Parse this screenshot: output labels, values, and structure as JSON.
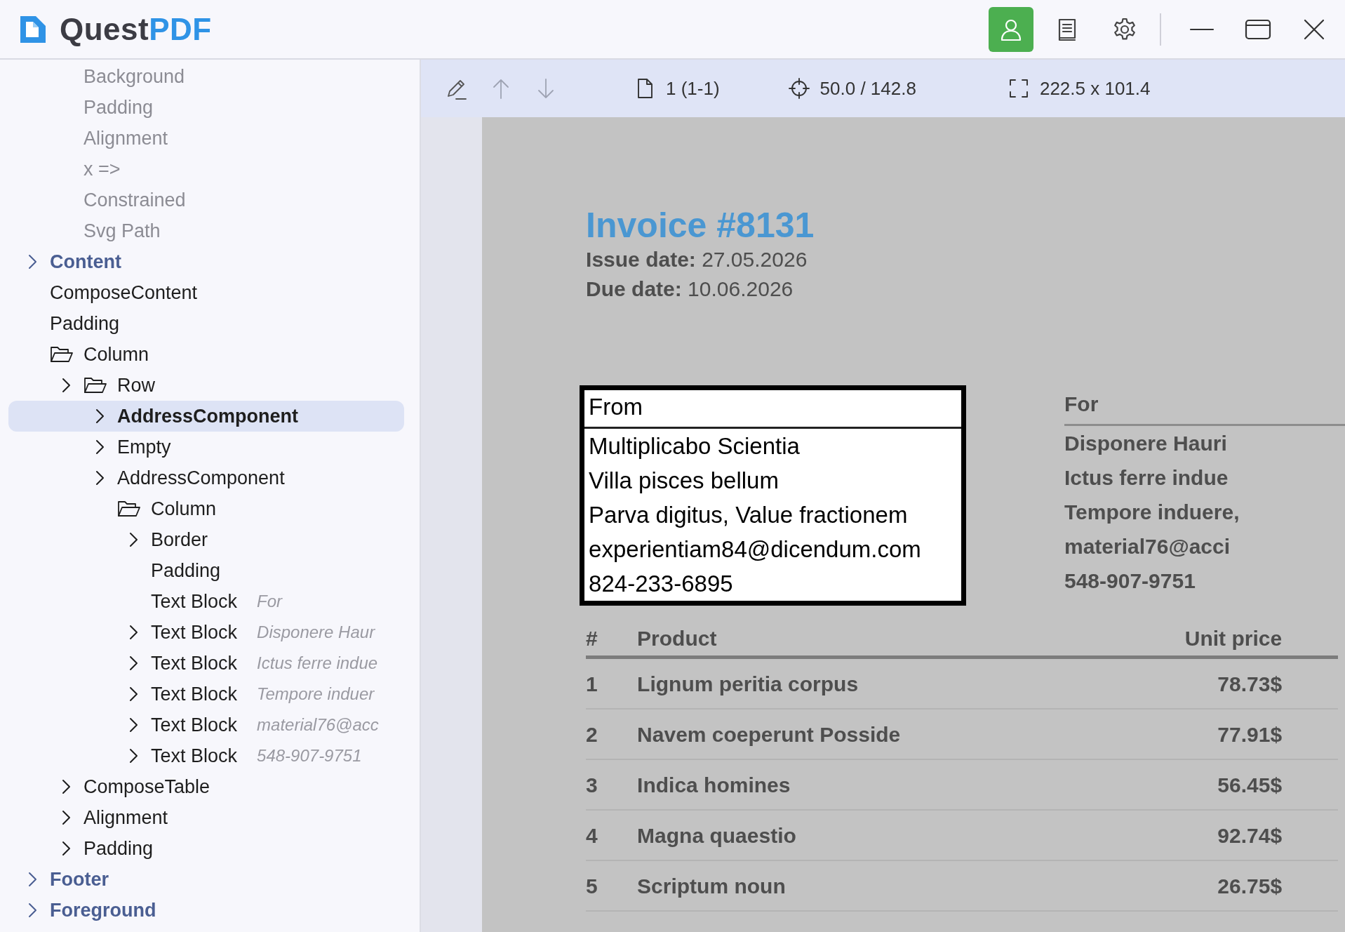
{
  "app": {
    "logo_main": "Quest",
    "logo_accent": "PDF"
  },
  "header_buttons": [
    {
      "kind": "user",
      "selected": true
    },
    {
      "kind": "book",
      "selected": false
    },
    {
      "kind": "settings",
      "selected": false
    }
  ],
  "tree": [
    {
      "children": [
        {
          "label": "Background",
          "kind": "hidden",
          "expandable": false,
          "selected": false
        },
        {
          "label": "Padding",
          "kind": "hidden",
          "expandable": false,
          "selected": false
        },
        {
          "label": "Alignment",
          "kind": "hidden",
          "expandable": false,
          "selected": false
        },
        {
          "label": "x =>",
          "kind": "hidden",
          "expandable": false,
          "selected": false
        },
        {
          "label": "Constrained",
          "kind": "hidden",
          "expandable": false,
          "selected": false
        },
        {
          "label": "Svg Path",
          "kind": "hidden",
          "expandable": false,
          "selected": false
        }
      ]
    },
    {
      "label": "Content",
      "kind": "section",
      "expandable": true,
      "selected": false
    },
    {
      "label": "ComposeContent",
      "kind": "node",
      "expandable": false,
      "selected": false
    },
    {
      "label": "Padding",
      "kind": "node",
      "expandable": false,
      "selected": false
    },
    {
      "label": "Column",
      "kind": "group",
      "expandable": false,
      "selected": false,
      "children": [
        {
          "label": "Row",
          "kind": "group",
          "expandable": true,
          "selected": false,
          "children": [
            {
              "label": "AddressComponent",
              "kind": "node",
              "expandable": true,
              "selected": true
            },
            {
              "label": "Empty",
              "kind": "node",
              "expandable": true,
              "selected": false
            },
            {
              "label": "AddressComponent",
              "kind": "node",
              "expandable": true,
              "selected": false
            },
            {
              "label": "Column",
              "kind": "group",
              "expandable": false,
              "selected": false,
              "children": [
                {
                  "label": "Border",
                  "kind": "node",
                  "expandable": true,
                  "selected": false
                },
                {
                  "label": "Padding",
                  "kind": "node",
                  "expandable": false,
                  "selected": false
                },
                {
                  "label": "Text Block",
                  "kind": "node",
                  "expandable": false,
                  "selected": false,
                  "hint": "For"
                },
                {
                  "label": "Text Block",
                  "kind": "node",
                  "expandable": true,
                  "selected": false,
                  "hint": "Disponere Haur"
                },
                {
                  "label": "Text Block",
                  "kind": "node",
                  "expandable": true,
                  "selected": false,
                  "hint": "Ictus ferre indue"
                },
                {
                  "label": "Text Block",
                  "kind": "node",
                  "expandable": true,
                  "selected": false,
                  "hint": "Tempore induer"
                },
                {
                  "label": "Text Block",
                  "kind": "node",
                  "expandable": true,
                  "selected": false,
                  "hint": "material76@acc"
                },
                {
                  "label": "Text Block",
                  "kind": "node",
                  "expandable": true,
                  "selected": false,
                  "hint": "548-907-9751"
                }
              ]
            }
          ]
        },
        {
          "label": "ComposeTable",
          "kind": "node",
          "expandable": true,
          "selected": false
        },
        {
          "label": "Alignment",
          "kind": "node",
          "expandable": true,
          "selected": false
        },
        {
          "label": "Padding",
          "kind": "node",
          "expandable": true,
          "selected": false
        }
      ]
    },
    {
      "label": "Footer",
      "kind": "section",
      "expandable": true,
      "selected": false
    },
    {
      "label": "Foreground",
      "kind": "section",
      "expandable": true,
      "selected": false
    }
  ],
  "toolbar": {
    "tools": [
      {
        "kind": "edit",
        "disabled": false
      },
      {
        "kind": "up",
        "disabled": true
      },
      {
        "kind": "down",
        "disabled": true
      }
    ],
    "page": "1 (1-1)",
    "position": "50.0 / 142.8",
    "size": "222.5 x 101.4"
  },
  "document": {
    "title": "Invoice #8131",
    "dates": [
      {
        "label": "Issue date:",
        "value": "27.05.2026"
      },
      {
        "label": "Due date:",
        "value": "10.06.2026"
      }
    ],
    "from": {
      "heading": "From",
      "lines": [
        "Multiplicabo Scientia",
        "Villa pisces bellum",
        "Parva digitus, Value fractionem",
        "experientiam84@dicendum.com",
        "824-233-6895"
      ]
    },
    "for": {
      "heading": "For",
      "lines": [
        "Disponere Hauri",
        "Ictus ferre indue",
        "Tempore induere,",
        "material76@acci",
        "548-907-9751"
      ]
    },
    "table": {
      "columns": [
        "#",
        "Product",
        "Unit price"
      ],
      "rows": [
        [
          "1",
          "Lignum peritia corpus",
          "78.73$"
        ],
        [
          "2",
          "Navem coeperunt Posside",
          "77.91$"
        ],
        [
          "3",
          "Indica homines",
          "56.45$"
        ],
        [
          "4",
          "Magna quaestio",
          "92.74$"
        ],
        [
          "5",
          "Scriptum noun",
          "26.75$"
        ]
      ]
    }
  }
}
